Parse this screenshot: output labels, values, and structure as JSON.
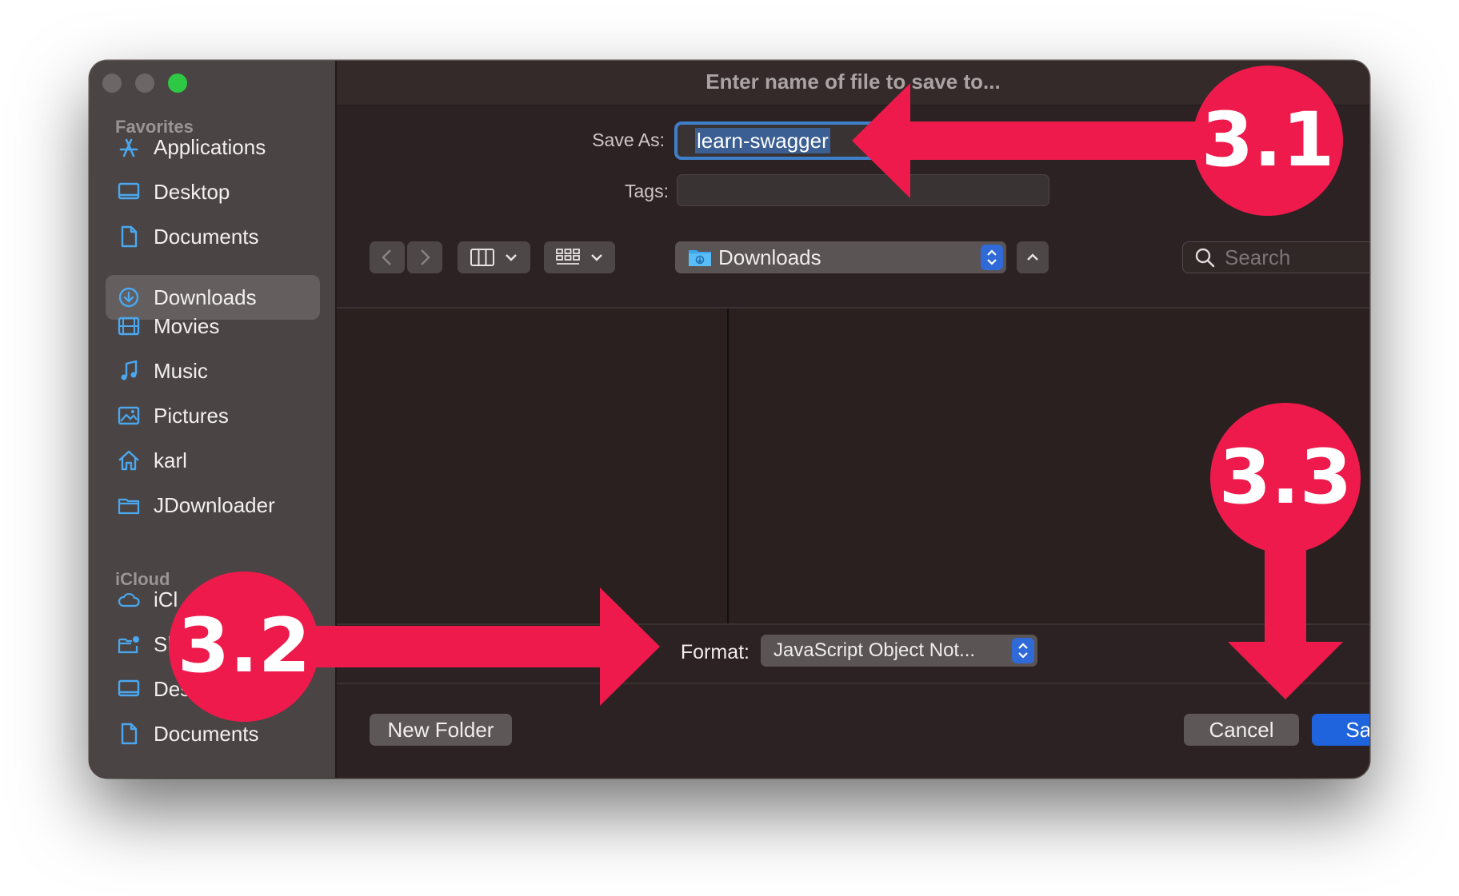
{
  "window": {
    "title": "Enter name of file to save to..."
  },
  "sidebar": {
    "favorites_title": "Favorites",
    "favorites": [
      {
        "label": "Applications",
        "icon": "applications-icon"
      },
      {
        "label": "Desktop",
        "icon": "desktop-icon"
      },
      {
        "label": "Documents",
        "icon": "document-icon"
      },
      {
        "label": "Downloads",
        "icon": "download-icon",
        "selected": true
      },
      {
        "label": "Movies",
        "icon": "film-icon"
      },
      {
        "label": "Music",
        "icon": "music-note-icon"
      },
      {
        "label": "Pictures",
        "icon": "picture-icon"
      },
      {
        "label": "karl",
        "icon": "home-icon"
      },
      {
        "label": "JDownloader",
        "icon": "folder-icon"
      }
    ],
    "icloud_title": "iCloud",
    "icloud": [
      {
        "label": "iCl",
        "icon": "cloud-icon"
      },
      {
        "label": "Sh",
        "icon": "shared-folder-icon"
      },
      {
        "label": "Desk",
        "icon": "desktop-icon"
      },
      {
        "label": "Documents",
        "icon": "document-icon"
      }
    ]
  },
  "form": {
    "save_as_label": "Save As:",
    "save_as_value": "learn-swagger",
    "tags_label": "Tags:",
    "tags_value": ""
  },
  "toolbar": {
    "location": "Downloads",
    "search_placeholder": "Search"
  },
  "format": {
    "label": "Format:",
    "value": "JavaScript Object Not..."
  },
  "buttons": {
    "new_folder": "New Folder",
    "cancel": "Cancel",
    "save": "Save"
  },
  "annotations": {
    "color": "#ee1a4b",
    "step1": "3.1",
    "step2": "3.2",
    "step3": "3.3"
  },
  "colors": {
    "accent_blue": "#1f63dd",
    "sidebar_icon": "#4aa8f0",
    "traffic_green": "#2fc845"
  }
}
